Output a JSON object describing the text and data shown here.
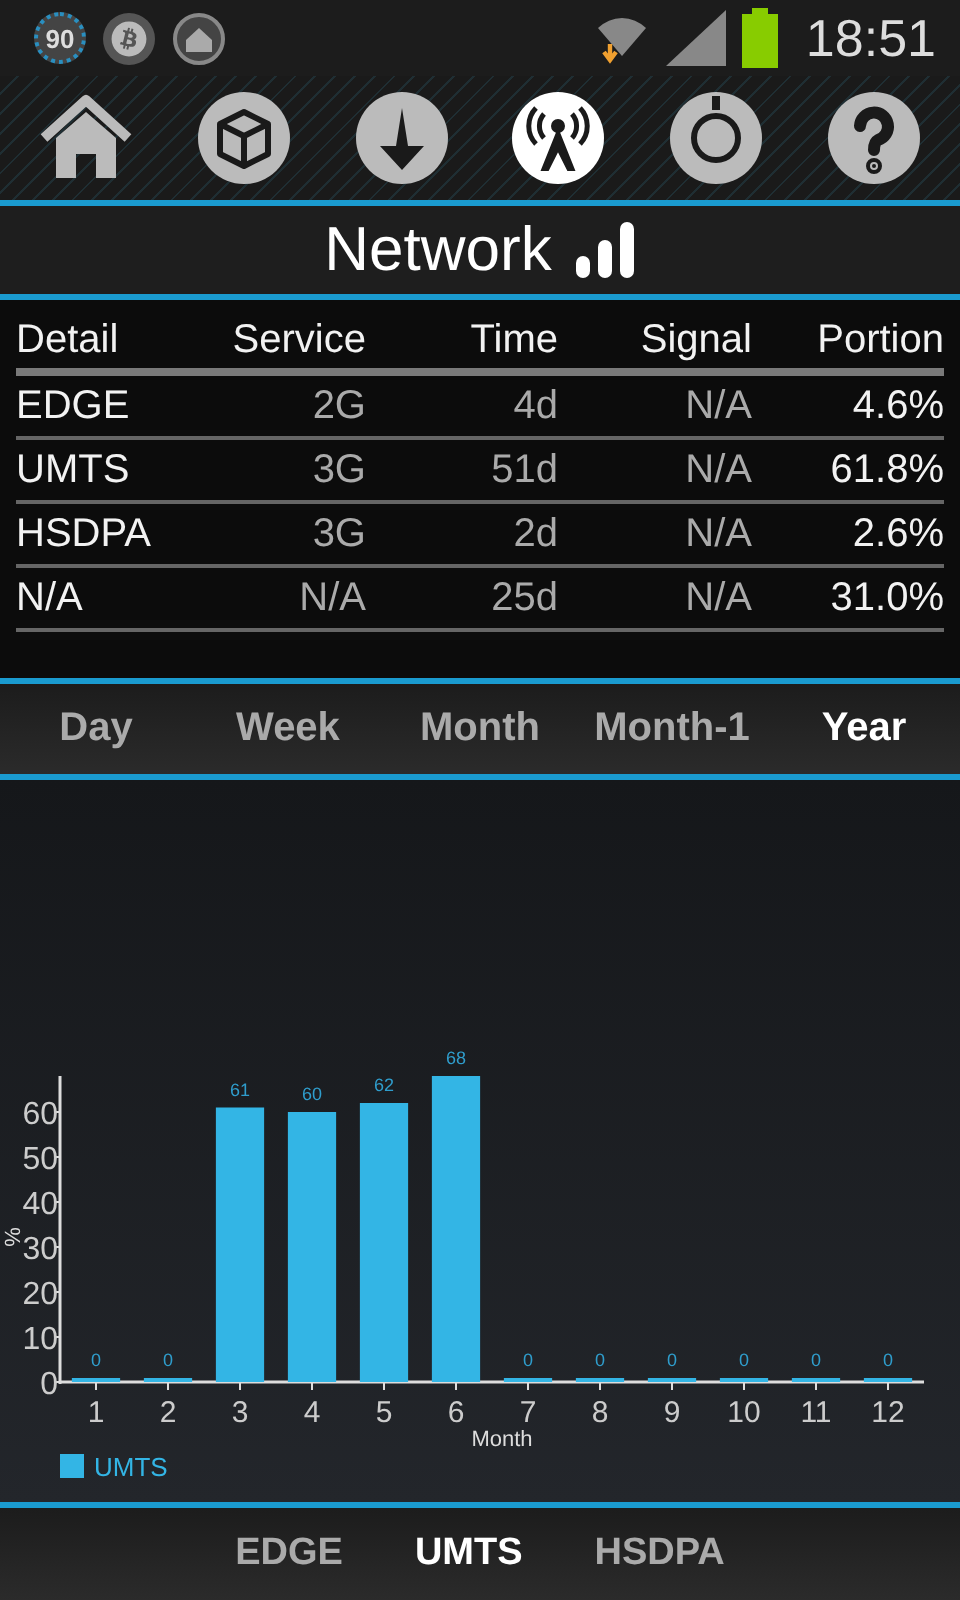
{
  "status_bar": {
    "badge": "90",
    "time": "18:51"
  },
  "toolbar": [
    {
      "kind": "home",
      "selected": false
    },
    {
      "kind": "box",
      "selected": false
    },
    {
      "kind": "download",
      "selected": false
    },
    {
      "kind": "antenna",
      "selected": true
    },
    {
      "kind": "ring",
      "selected": false
    },
    {
      "kind": "help",
      "selected": false
    }
  ],
  "title": "Network",
  "table": {
    "columns": [
      "Detail",
      "Service",
      "Time",
      "Signal",
      "Portion"
    ],
    "rows": [
      [
        "EDGE",
        "2G",
        "4d",
        "N/A",
        "4.6%"
      ],
      [
        "UMTS",
        "3G",
        "51d",
        "N/A",
        "61.8%"
      ],
      [
        "HSDPA",
        "3G",
        "2d",
        "N/A",
        "2.6%"
      ],
      [
        "N/A",
        "N/A",
        "25d",
        "N/A",
        "31.0%"
      ]
    ]
  },
  "period_tabs": [
    {
      "label": "Day",
      "selected": false
    },
    {
      "label": "Week",
      "selected": false
    },
    {
      "label": "Month",
      "selected": false
    },
    {
      "label": "Month-1",
      "selected": false
    },
    {
      "label": "Year",
      "selected": true
    }
  ],
  "chart_data": {
    "type": "bar",
    "xlabel": "Month",
    "ylabel": "%",
    "categories": [
      "1",
      "2",
      "3",
      "4",
      "5",
      "6",
      "7",
      "8",
      "9",
      "10",
      "11",
      "12"
    ],
    "series": [
      {
        "name": "UMTS",
        "color": "#33b5e5",
        "values": [
          0,
          0,
          61,
          60,
          62,
          68,
          0,
          0,
          0,
          0,
          0,
          0
        ]
      }
    ],
    "ylim": [
      0,
      68
    ],
    "yticks": [
      0,
      10,
      20,
      30,
      40,
      50,
      60
    ],
    "data_labels": true
  },
  "network_tabs": [
    {
      "label": "EDGE",
      "selected": false
    },
    {
      "label": "UMTS",
      "selected": true
    },
    {
      "label": "HSDPA",
      "selected": false
    }
  ]
}
